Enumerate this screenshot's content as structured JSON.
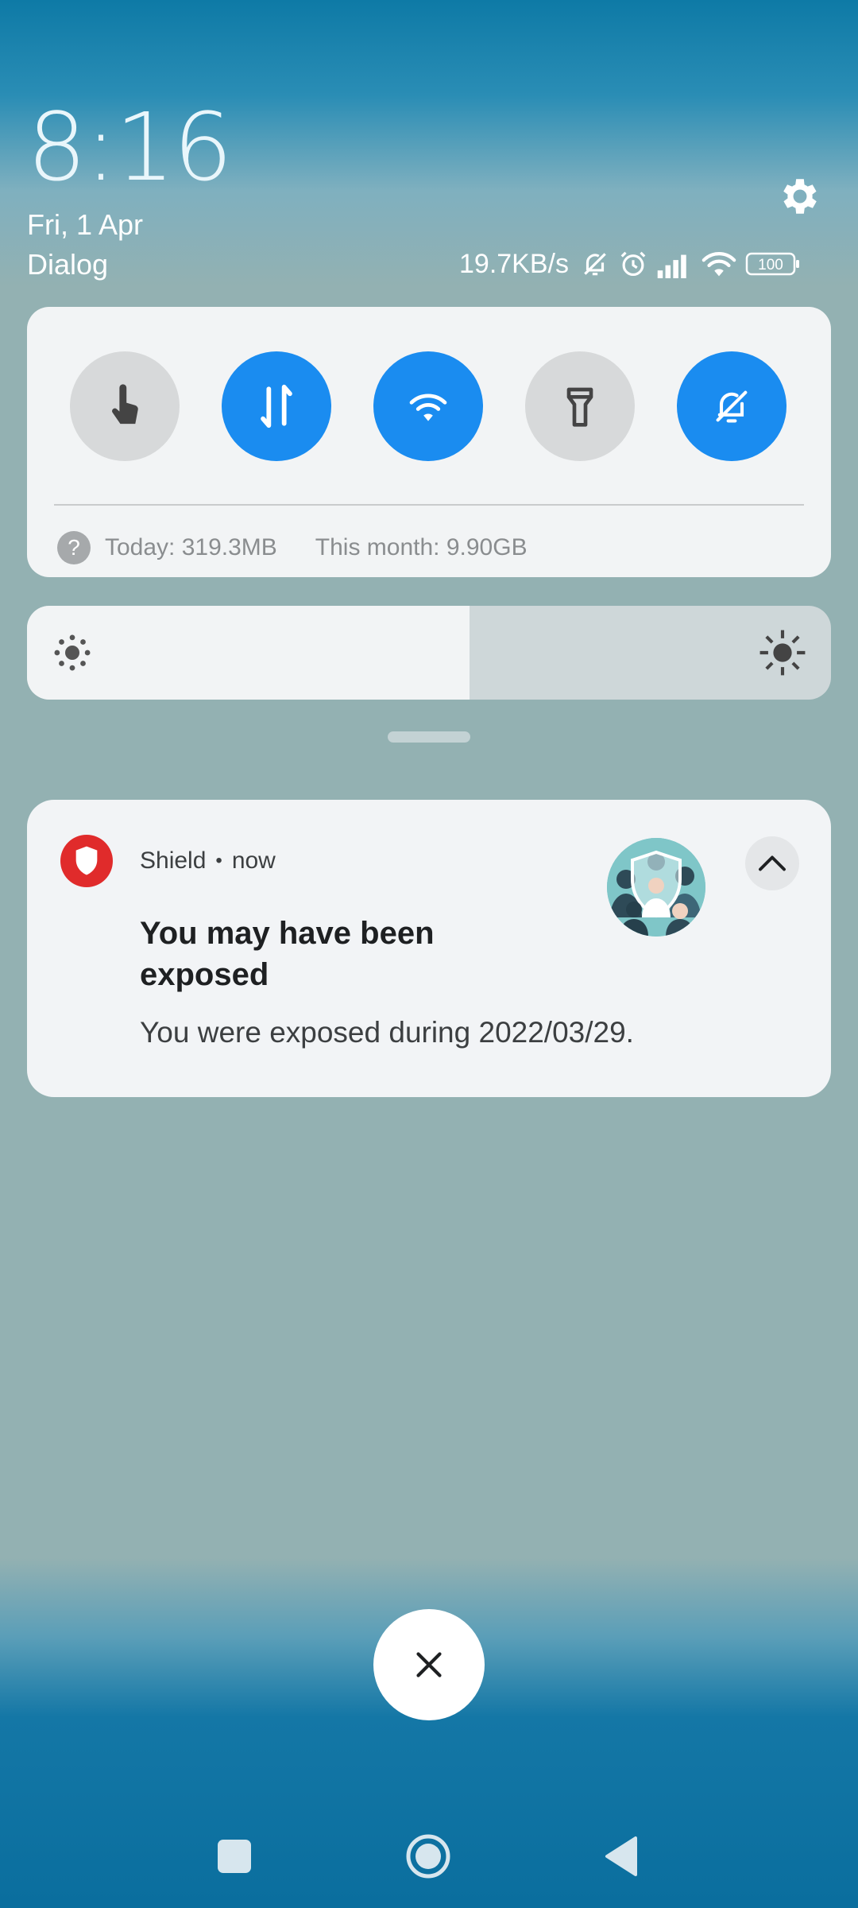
{
  "lockscreen": {
    "time": "8:16",
    "date": "Fri, 1 Apr",
    "carrier": "Dialog"
  },
  "status_bar": {
    "net_speed": "19.7KB/s",
    "battery": "100",
    "icons": [
      "bell-off-icon",
      "alarm-icon",
      "signal-icon",
      "wifi-icon",
      "battery-icon"
    ]
  },
  "quick_settings": {
    "tiles": [
      {
        "icon": "touch-icon",
        "state": "off"
      },
      {
        "icon": "mobile-data-icon",
        "state": "on"
      },
      {
        "icon": "wifi-icon",
        "state": "on"
      },
      {
        "icon": "flashlight-icon",
        "state": "off"
      },
      {
        "icon": "bell-off-icon",
        "state": "on"
      }
    ],
    "usage_today": "Today: 319.3MB",
    "usage_month": "This month: 9.90GB",
    "help_glyph": "?"
  },
  "brightness": {
    "level": 0.55
  },
  "notification": {
    "app_name": "Shield",
    "separator": "•",
    "time": "now",
    "title": "You may have been exposed",
    "body": "You were exposed during 2022/03/29."
  },
  "colors": {
    "accent": "#1a8cf0",
    "app_icon": "#e02b2b"
  }
}
